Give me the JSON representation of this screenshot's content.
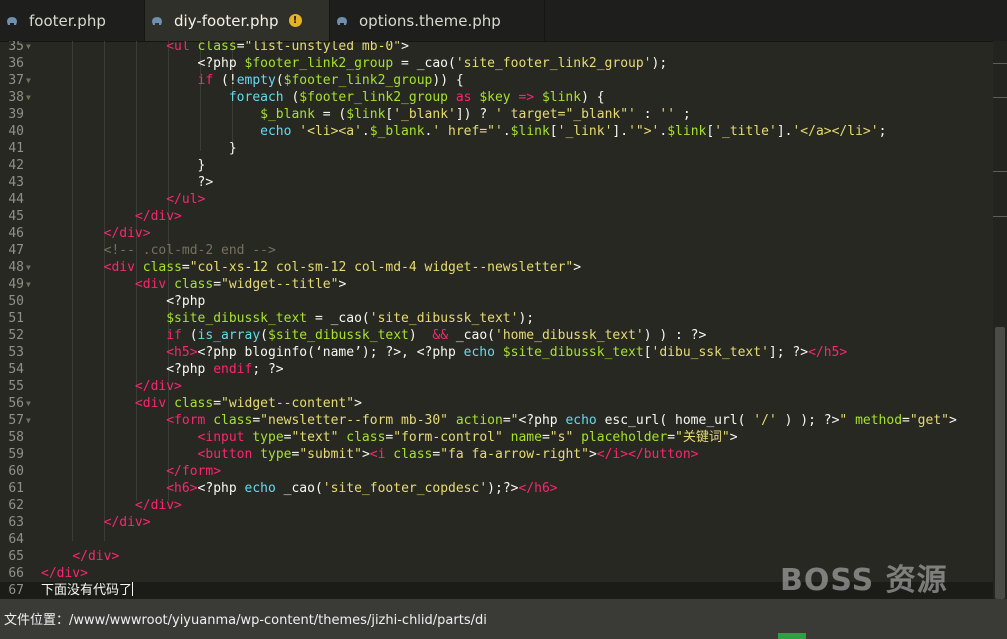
{
  "tabs": [
    {
      "label": "footer.php",
      "active": false,
      "modified": false
    },
    {
      "label": "diy-footer.php",
      "active": true,
      "modified": true
    },
    {
      "label": "options.theme.php",
      "active": false,
      "modified": false
    }
  ],
  "editor": {
    "lines": [
      {
        "n": "35",
        "fold": true,
        "html": "                <span class=\"t-tag\">&lt;ul</span> <span class=\"t-attr\">class</span>=<span class=\"t-str\">\"list-unstyled mb-0\"</span>&gt;"
      },
      {
        "n": "36",
        "fold": false,
        "html": "                    &lt;?php <span class=\"t-var\">$footer_link2_group</span> = _cao(<span class=\"t-str\">'site_footer_link2_group'</span>);"
      },
      {
        "n": "37",
        "fold": true,
        "html": "                    <span class=\"t-tag\">if</span> (!<span class=\"t-kw\">empty</span>(<span class=\"t-var\">$footer_link2_group</span>)) {"
      },
      {
        "n": "38",
        "fold": true,
        "html": "                        <span class=\"t-kw\">foreach</span> (<span class=\"t-var\">$footer_link2_group</span> <span class=\"t-tag\">as</span> <span class=\"t-var\">$key</span> <span class=\"t-tag\">=&gt;</span> <span class=\"t-var\">$link</span>) {"
      },
      {
        "n": "39",
        "fold": false,
        "html": "                            <span class=\"t-var\">$_blank</span> = (<span class=\"t-var\">$link</span>[<span class=\"t-str\">'_blank'</span>]) ? <span class=\"t-str\">' target=\"_blank\"'</span> : <span class=\"t-str\">''</span> ;"
      },
      {
        "n": "40",
        "fold": false,
        "html": "                            <span class=\"t-kw\">echo</span> <span class=\"t-str\">'&lt;li&gt;&lt;a'</span>.<span class=\"t-var\">$_blank</span>.<span class=\"t-str\">' href=\"'</span>.<span class=\"t-var\">$link</span>[<span class=\"t-str\">'_link'</span>].<span class=\"t-str\">'\"&gt;'</span>.<span class=\"t-var\">$link</span>[<span class=\"t-str\">'_title'</span>].<span class=\"t-str\">'&lt;/a&gt;&lt;/li&gt;'</span>;"
      },
      {
        "n": "41",
        "fold": false,
        "html": "                        }"
      },
      {
        "n": "42",
        "fold": false,
        "html": "                    }"
      },
      {
        "n": "43",
        "fold": false,
        "html": "                    ?&gt;"
      },
      {
        "n": "44",
        "fold": false,
        "html": "                <span class=\"t-tag\">&lt;/ul&gt;</span>"
      },
      {
        "n": "45",
        "fold": false,
        "html": "            <span class=\"t-tag\">&lt;/div&gt;</span>"
      },
      {
        "n": "46",
        "fold": false,
        "html": "        <span class=\"t-tag\">&lt;/div&gt;</span>"
      },
      {
        "n": "47",
        "fold": false,
        "html": "        <span class=\"t-cmt\">&lt;!-- .col-md-2 end --&gt;</span>"
      },
      {
        "n": "48",
        "fold": true,
        "html": "        <span class=\"t-tag\">&lt;div</span> <span class=\"t-attr\">class</span>=<span class=\"t-str\">\"col-xs-12 col-sm-12 col-md-4 widget--newsletter\"</span>&gt;"
      },
      {
        "n": "49",
        "fold": true,
        "html": "            <span class=\"t-tag\">&lt;div</span> <span class=\"t-attr\">class</span>=<span class=\"t-str\">\"widget--title\"</span>&gt;"
      },
      {
        "n": "50",
        "fold": false,
        "html": "                &lt;?php"
      },
      {
        "n": "51",
        "fold": false,
        "html": "                <span class=\"t-var\">$site_dibussk_text</span> = _cao(<span class=\"t-str\">'site_dibussk_text'</span>);"
      },
      {
        "n": "52",
        "fold": false,
        "html": "                <span class=\"t-tag\">if</span> (<span class=\"t-kw\">is_array</span>(<span class=\"t-var\">$site_dibussk_text</span>)  <span class=\"t-tag\">&amp;&amp;</span> _cao(<span class=\"t-str\">'home_dibussk_text'</span>) ) : ?&gt;"
      },
      {
        "n": "53",
        "fold": false,
        "html": "                <span class=\"t-tag\">&lt;h5&gt;</span>&lt;?php bloginfo(‘name’); ?&gt;, &lt;?php <span class=\"t-kw\">echo</span> <span class=\"t-var\">$site_dibussk_text</span>[<span class=\"t-str\">'dibu_ssk_text'</span>]; ?&gt;<span class=\"t-tag\">&lt;/h5&gt;</span>"
      },
      {
        "n": "54",
        "fold": false,
        "html": "                &lt;?php <span class=\"t-tag\">endif</span>; ?&gt;"
      },
      {
        "n": "55",
        "fold": false,
        "html": "            <span class=\"t-tag\">&lt;/div&gt;</span>"
      },
      {
        "n": "56",
        "fold": true,
        "html": "            <span class=\"t-tag\">&lt;div</span> <span class=\"t-attr\">class</span>=<span class=\"t-str\">\"widget--content\"</span>&gt;"
      },
      {
        "n": "57",
        "fold": true,
        "html": "                <span class=\"t-tag\">&lt;form</span> <span class=\"t-attr\">class</span>=<span class=\"t-str\">\"newsletter--form mb-30\"</span> <span class=\"t-attr\">action</span>=<span class=\"t-str\">\"</span>&lt;?php <span class=\"t-kw\">echo</span> esc_url( home_url( <span class=\"t-str\">'/'</span> ) ); ?&gt;<span class=\"t-str\">\"</span> <span class=\"t-attr\">method</span>=<span class=\"t-str\">\"get\"</span>&gt;"
      },
      {
        "n": "58",
        "fold": false,
        "html": "                    <span class=\"t-tag\">&lt;input</span> <span class=\"t-attr\">type</span>=<span class=\"t-str\">\"text\"</span> <span class=\"t-attr\">class</span>=<span class=\"t-str\">\"form-control\"</span> <span class=\"t-attr\">name</span>=<span class=\"t-str\">\"s\"</span> <span class=\"t-attr\">placeholder</span>=<span class=\"t-str\">\"关键词\"</span>&gt;"
      },
      {
        "n": "59",
        "fold": false,
        "html": "                    <span class=\"t-tag\">&lt;button</span> <span class=\"t-attr\">type</span>=<span class=\"t-str\">\"submit\"</span>&gt;<span class=\"t-tag\">&lt;i</span> <span class=\"t-attr\">class</span>=<span class=\"t-str\">\"fa fa-arrow-right\"</span>&gt;<span class=\"t-tag\">&lt;/i&gt;&lt;/button&gt;</span>"
      },
      {
        "n": "60",
        "fold": false,
        "html": "                <span class=\"t-tag\">&lt;/form&gt;</span>"
      },
      {
        "n": "61",
        "fold": false,
        "html": "                <span class=\"t-tag\">&lt;h6&gt;</span>&lt;?php <span class=\"t-kw\">echo</span> _cao(<span class=\"t-str\">'site_footer_copdesc'</span>);?&gt;<span class=\"t-tag\">&lt;/h6&gt;</span>"
      },
      {
        "n": "62",
        "fold": false,
        "html": "            <span class=\"t-tag\">&lt;/div&gt;</span>"
      },
      {
        "n": "63",
        "fold": false,
        "html": "        <span class=\"t-tag\">&lt;/div&gt;</span>"
      },
      {
        "n": "64",
        "fold": false,
        "html": ""
      },
      {
        "n": "65",
        "fold": false,
        "html": "    <span class=\"t-tag\">&lt;/div&gt;</span>"
      },
      {
        "n": "66",
        "fold": false,
        "html": "<span class=\"t-tag\">&lt;/div&gt;</span>"
      },
      {
        "n": "67",
        "fold": false,
        "html": "下面没有代码了",
        "cursor": true
      }
    ]
  },
  "watermark": "BOSS 资源",
  "status": {
    "path": "文件位置：/www/wwwroot/yiyuanma/wp-content/themes/jizhi-chlid/parts/diy"
  },
  "colors": {
    "background": "#272822",
    "tag": "#f92672",
    "attr": "#a6e22e",
    "string": "#e6db74",
    "keyword": "#66d9ef",
    "comment": "#75715e",
    "warning": "#e6b422"
  }
}
